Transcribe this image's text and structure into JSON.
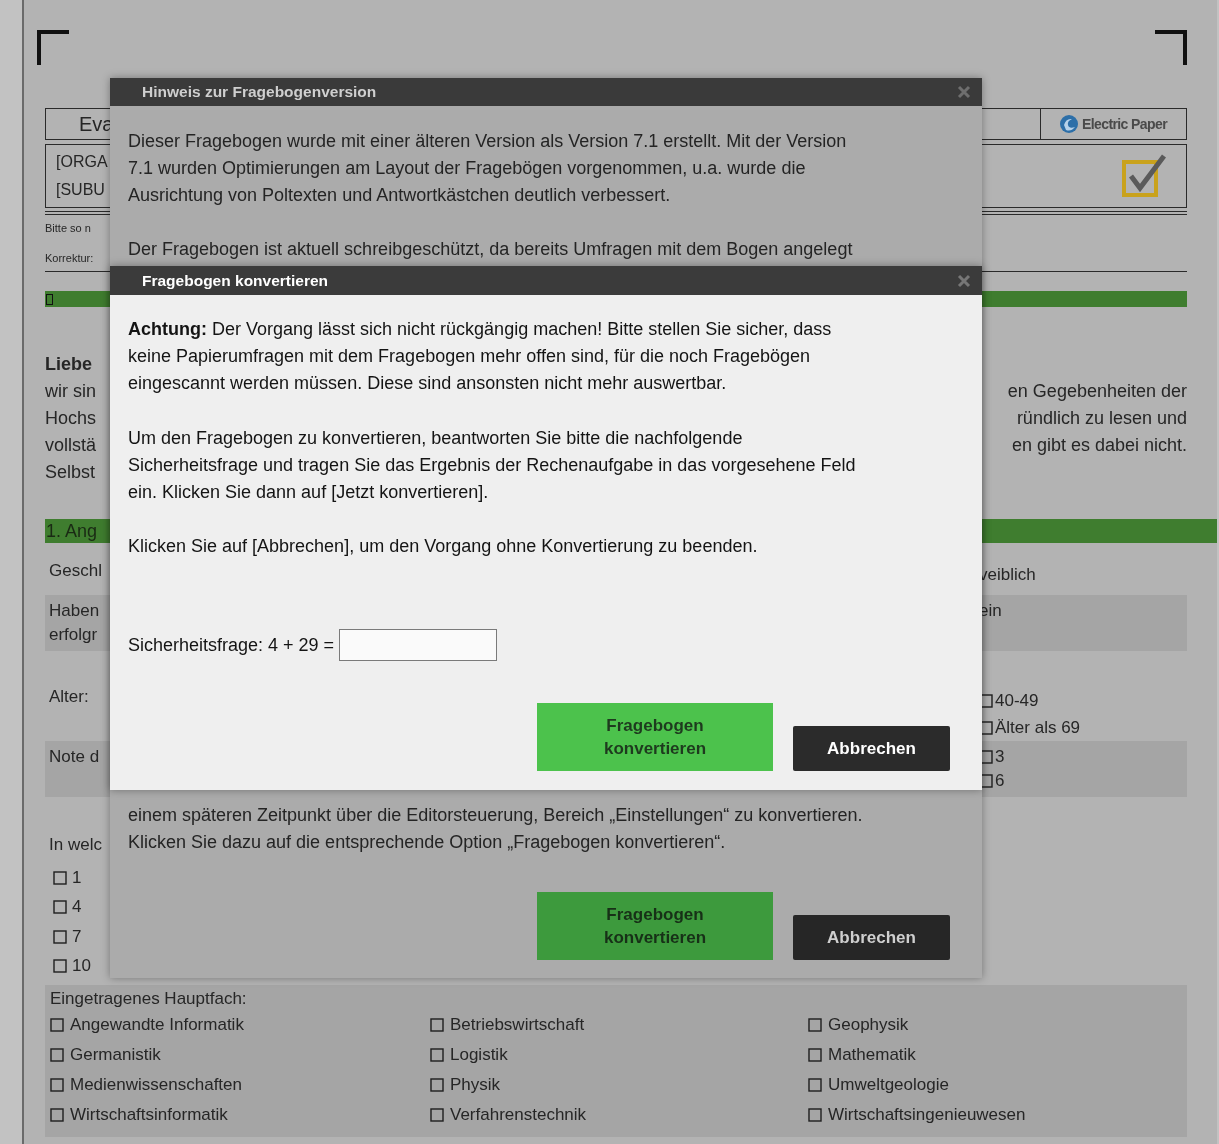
{
  "form": {
    "header": {
      "title": "Eva",
      "org_lines": [
        "[ORGA",
        "[SUBU"
      ],
      "logo_text": "Electric Paper"
    },
    "notes": [
      "Bitte so n",
      "Korrektur:"
    ],
    "progress": {
      "level": 0.01
    },
    "greeting": "Liebe",
    "intro_left": [
      "wir sin",
      "Hochs",
      "vollstä",
      "Selbst"
    ],
    "intro_right": [
      "en Gegebenheiten der",
      "ründlich zu lesen und",
      "en gibt es dabei nicht."
    ],
    "section_title": "1. Ang",
    "questions": [
      {
        "shaded": false,
        "left": [
          "Geschl"
        ],
        "right": [
          {
            "kind": "text",
            "label": "veiblich"
          }
        ]
      },
      {
        "shaded": true,
        "left": [
          "Haben",
          "erfolgr"
        ],
        "right": [
          {
            "kind": "text",
            "label": "ein"
          }
        ]
      },
      {
        "shaded": false,
        "left": [
          "Alter:"
        ],
        "right": [
          {
            "kind": "checkbox",
            "label": "40-49",
            "checked": false
          },
          {
            "kind": "checkbox",
            "label": "Älter als 69",
            "checked": false
          }
        ]
      },
      {
        "shaded": true,
        "left": [
          "Note d"
        ],
        "right": [
          {
            "kind": "checkbox",
            "label": "3",
            "checked": false
          },
          {
            "kind": "checkbox",
            "label": "6",
            "checked": false
          }
        ]
      }
    ],
    "semester_question": "In welc",
    "semester_options": [
      {
        "label": "1",
        "checked": false
      },
      {
        "label": "4",
        "checked": false
      },
      {
        "label": "7",
        "checked": false
      },
      {
        "label": "10",
        "checked": false
      }
    ],
    "major": {
      "label": "Eingetragenes Hauptfach:",
      "options": [
        {
          "label": "Angewandte Informatik",
          "checked": false
        },
        {
          "label": "Betriebswirtschaft",
          "checked": false
        },
        {
          "label": "Geophysik",
          "checked": false
        },
        {
          "label": "Germanistik",
          "checked": false
        },
        {
          "label": "Logistik",
          "checked": false
        },
        {
          "label": "Mathematik",
          "checked": false
        },
        {
          "label": "Medienwissenschaften",
          "checked": false
        },
        {
          "label": "Physik",
          "checked": false
        },
        {
          "label": "Umweltgeologie",
          "checked": false
        },
        {
          "label": "Wirtschaftsinformatik",
          "checked": false
        },
        {
          "label": "Verfahrenstechnik",
          "checked": false
        },
        {
          "label": "Wirtschaftsingenieuwesen",
          "checked": false
        }
      ]
    }
  },
  "dialogs": [
    {
      "title": "Hinweis zur Fragebogenversion",
      "active": false,
      "paragraphs": [
        {
          "lines": [
            "Dieser Fragebogen wurde mit einer älteren Version als Version 7.1 erstellt. Mit der Version",
            "7.1 wurden Optimierungen am Layout der Fragebögen vorgenommen, u.a. wurde die",
            "Ausrichtung von Poltexten und Antwortkästchen deutlich verbessert."
          ]
        },
        {
          "lines": [
            "Der Fragebogen ist aktuell schreibgeschützt, da bereits Umfragen mit dem Bogen angelegt"
          ]
        },
        {
          "lines": [
            "einem späteren Zeitpunkt über die Editorsteuerung, Bereich „Einstellungen“ zu konvertieren.",
            "Klicken Sie dazu auf die entsprechende Option „Fragebogen konvertieren“."
          ]
        }
      ],
      "buttons": [
        {
          "kind": "primary",
          "label": "Fragebogen konvertieren"
        },
        {
          "kind": "secondary",
          "label": "Abbrechen"
        }
      ]
    },
    {
      "title": "Fragebogen konvertieren",
      "active": true,
      "paragraphs": [
        {
          "lines": [
            "**Achtung:** Der Vorgang lässt sich nicht rückgängig machen! Bitte stellen Sie sicher, dass",
            "keine Papierumfragen mit dem Fragebogen mehr offen sind, für die noch Fragebögen",
            "eingescannt werden müssen. Diese sind ansonsten nicht mehr auswertbar."
          ]
        },
        {
          "lines": [
            "Um den Fragebogen zu konvertieren, beantworten Sie bitte die nachfolgende",
            "Sicherheitsfrage und tragen Sie das Ergebnis der Rechenaufgabe in das vorgesehene Feld",
            "ein. Klicken Sie dann auf [Jetzt konvertieren]."
          ]
        },
        {
          "lines": [
            "Klicken Sie auf [Abbrechen], um den Vorgang ohne Konvertierung zu beenden."
          ]
        }
      ],
      "security_field": {
        "label": "Sicherheitsfrage: 4 + 29 ="
      },
      "buttons": [
        {
          "kind": "primary",
          "label": "Fragebogen konvertieren"
        },
        {
          "kind": "secondary",
          "label": "Abbrechen"
        }
      ]
    }
  ]
}
